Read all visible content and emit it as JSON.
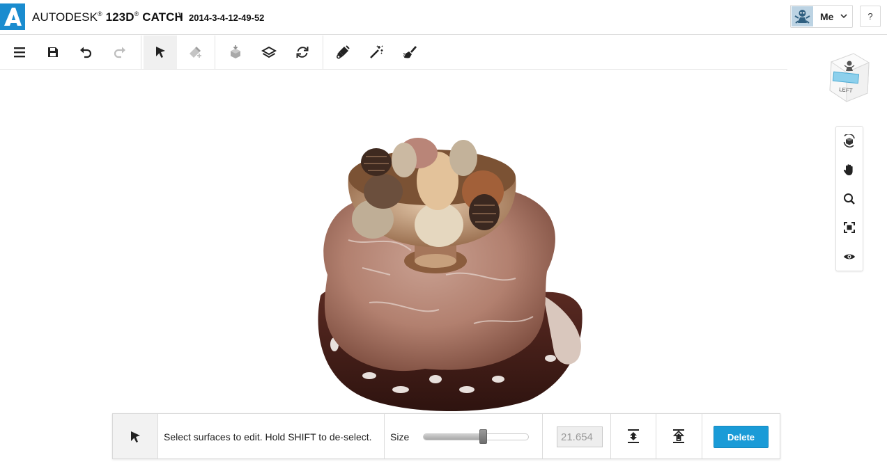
{
  "header": {
    "brand_regular": "AUTODESK",
    "brand_bold": "123D",
    "brand_product": "CATCH",
    "breadcrumb_separator": "\\",
    "filename": "2014-3-4-12-49-52",
    "user_label": "Me",
    "help_label": "?"
  },
  "toolbar": {
    "items": [
      {
        "name": "menu-icon",
        "state": "enabled"
      },
      {
        "name": "save-icon",
        "state": "enabled"
      },
      {
        "name": "undo-icon",
        "state": "enabled"
      },
      {
        "name": "redo-icon",
        "state": "disabled"
      },
      {
        "name": "select-arrow-icon",
        "state": "active"
      },
      {
        "name": "eraser-add-icon",
        "state": "disabled"
      },
      {
        "name": "cube-drop-icon",
        "state": "disabled"
      },
      {
        "name": "layers-icon",
        "state": "enabled"
      },
      {
        "name": "refresh-icon",
        "state": "enabled"
      },
      {
        "name": "paint-tool-icon",
        "state": "enabled"
      },
      {
        "name": "magic-wand-icon",
        "state": "enabled"
      },
      {
        "name": "brush-icon",
        "state": "enabled"
      }
    ]
  },
  "viewcube": {
    "face_label": "LEFT"
  },
  "navbar": {
    "items": [
      "orbit-icon",
      "pan-hand-icon",
      "zoom-icon",
      "fit-view-icon",
      "visibility-eye-icon"
    ]
  },
  "panel": {
    "hint": "Select surfaces to edit. Hold SHIFT to de-select.",
    "size_label": "Size",
    "size_value": "21.654",
    "slider_fraction": 0.57,
    "delete_label": "Delete"
  },
  "colors": {
    "accent": "#1a9bd7",
    "brand_blue": "#1a8ccf"
  }
}
